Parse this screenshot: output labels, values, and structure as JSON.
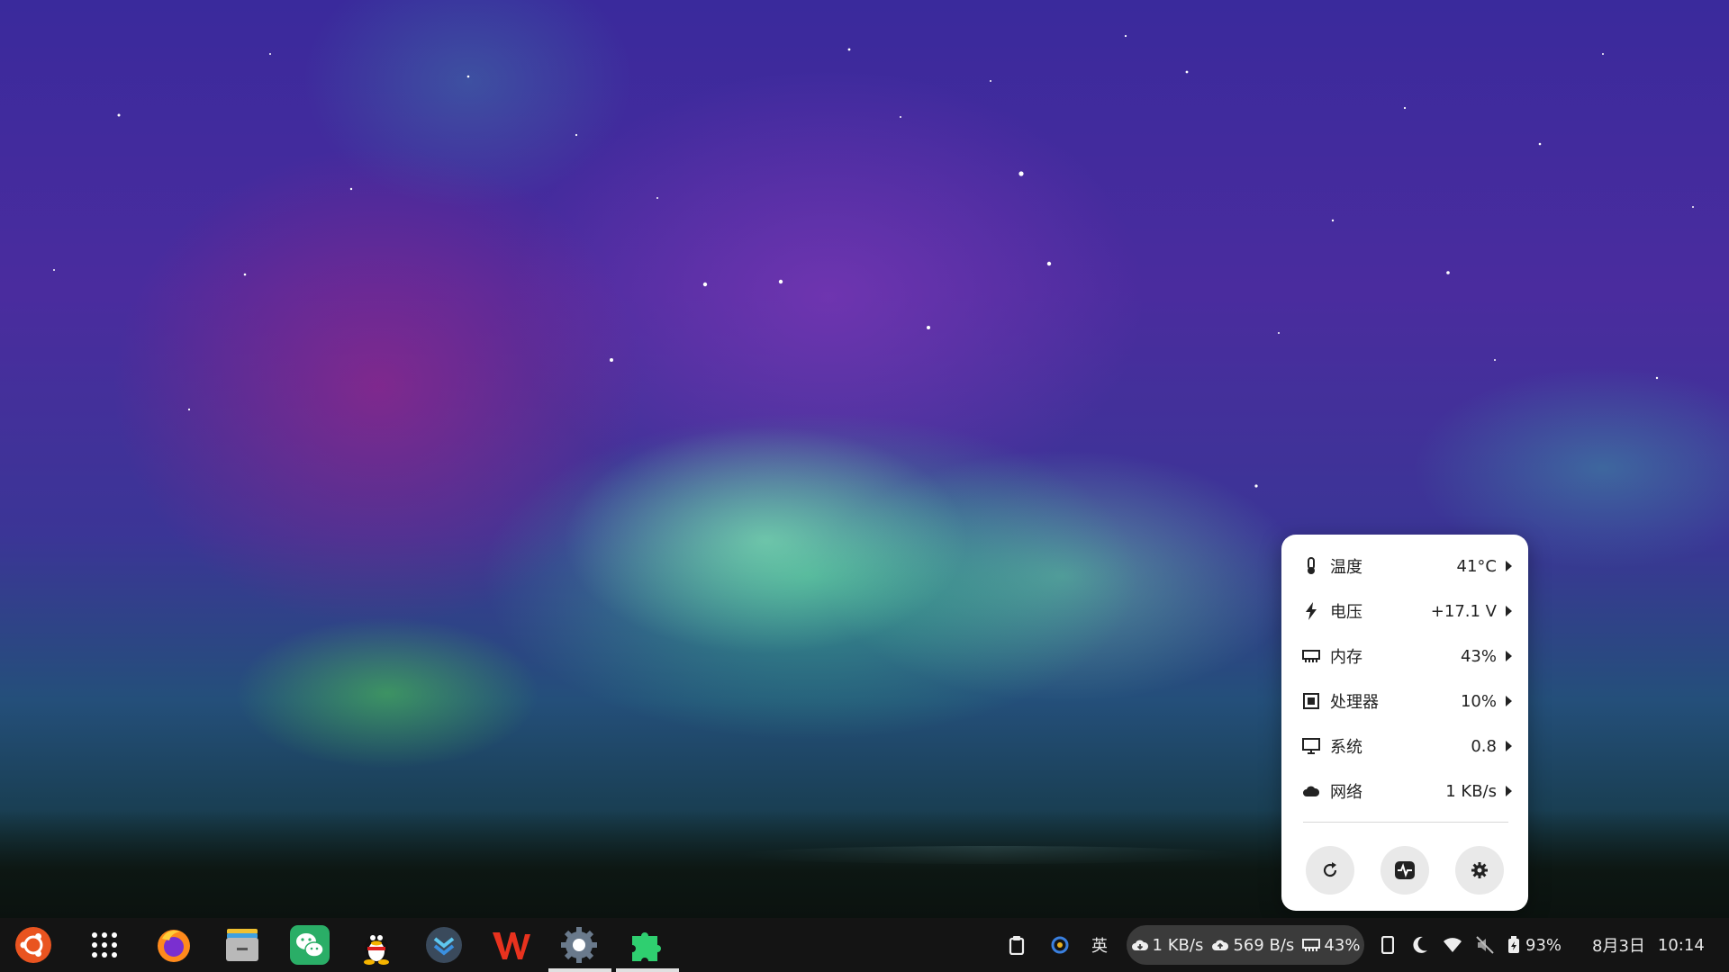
{
  "popup": {
    "rows": [
      {
        "label": "温度",
        "value": "41°C",
        "icon": "thermometer-icon"
      },
      {
        "label": "电压",
        "value": "+17.1 V",
        "icon": "bolt-icon"
      },
      {
        "label": "内存",
        "value": "43%",
        "icon": "memory-icon"
      },
      {
        "label": "处理器",
        "value": "10%",
        "icon": "cpu-icon"
      },
      {
        "label": "系统",
        "value": "0.8",
        "icon": "monitor-icon"
      },
      {
        "label": "网络",
        "value": "1 KB/s",
        "icon": "cloud-icon"
      }
    ],
    "buttons": [
      "refresh-icon",
      "activity-monitor-icon",
      "settings-icon"
    ]
  },
  "taskbar": {
    "apps": [
      "ubuntu-logo",
      "app-grid",
      "firefox",
      "files",
      "wechat",
      "qq",
      "todo",
      "wps",
      "settings",
      "extensions"
    ],
    "tray": {
      "input_method": "英",
      "net_down": "1 KB/s",
      "net_up": "569 B/s",
      "memory": "43%",
      "battery": "93%",
      "date": "8月3日",
      "time": "10:14"
    }
  },
  "colors": {
    "taskbar": "#141414",
    "popup_bg": "#ffffff",
    "accent_orange": "#e95420",
    "wechat_green": "#2aae67"
  }
}
